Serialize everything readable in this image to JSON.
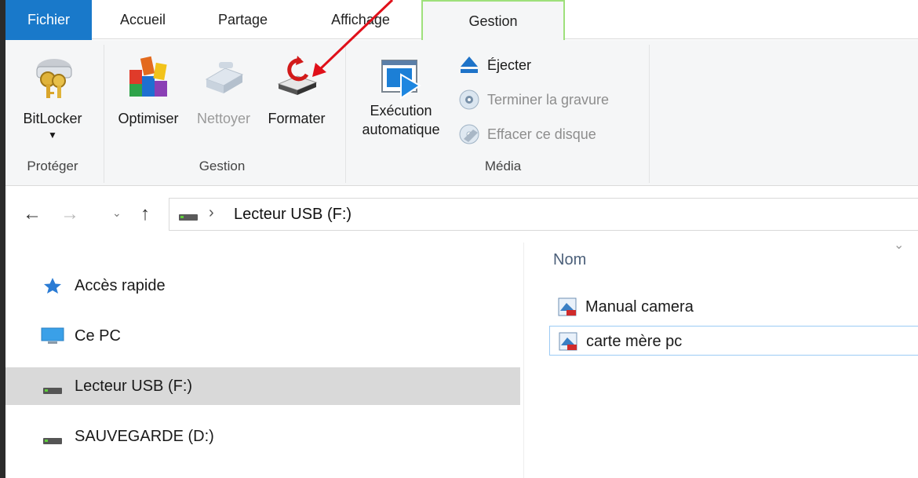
{
  "tabs": {
    "file": "Fichier",
    "home": "Accueil",
    "share": "Partage",
    "view": "Affichage",
    "manage": "Gestion"
  },
  "ribbon": {
    "protect": {
      "bitlocker": "BitLocker",
      "group": "Protéger"
    },
    "manage": {
      "optimize": "Optimiser",
      "cleanup": "Nettoyer",
      "format": "Formater",
      "group": "Gestion"
    },
    "media": {
      "autoplay_line1": "Exécution",
      "autoplay_line2": "automatique",
      "eject": "Éjecter",
      "finish_burning": "Terminer la gravure",
      "erase_disc": "Effacer ce disque",
      "group": "Média"
    }
  },
  "address": {
    "path": "Lecteur USB (F:)"
  },
  "nav_pane": {
    "items": [
      {
        "label": "Accès rapide",
        "icon": "star-icon"
      },
      {
        "label": "Ce PC",
        "icon": "computer-icon"
      },
      {
        "label": "Lecteur USB (F:)",
        "icon": "drive-icon",
        "selected": true
      },
      {
        "label": "SAUVEGARDE (D:)",
        "icon": "drive-icon"
      }
    ]
  },
  "content": {
    "column_name": "Nom",
    "files": [
      {
        "name": "Manual camera",
        "icon": "pdf-file-icon"
      },
      {
        "name": "carte mère pc",
        "icon": "pdf-file-icon",
        "focused": true
      }
    ]
  },
  "colors": {
    "file_tab": "#1979ca",
    "manage_tab_border": "#9ee07b",
    "annotation_arrow": "#e0101a",
    "selection": "#d9d9d9"
  }
}
